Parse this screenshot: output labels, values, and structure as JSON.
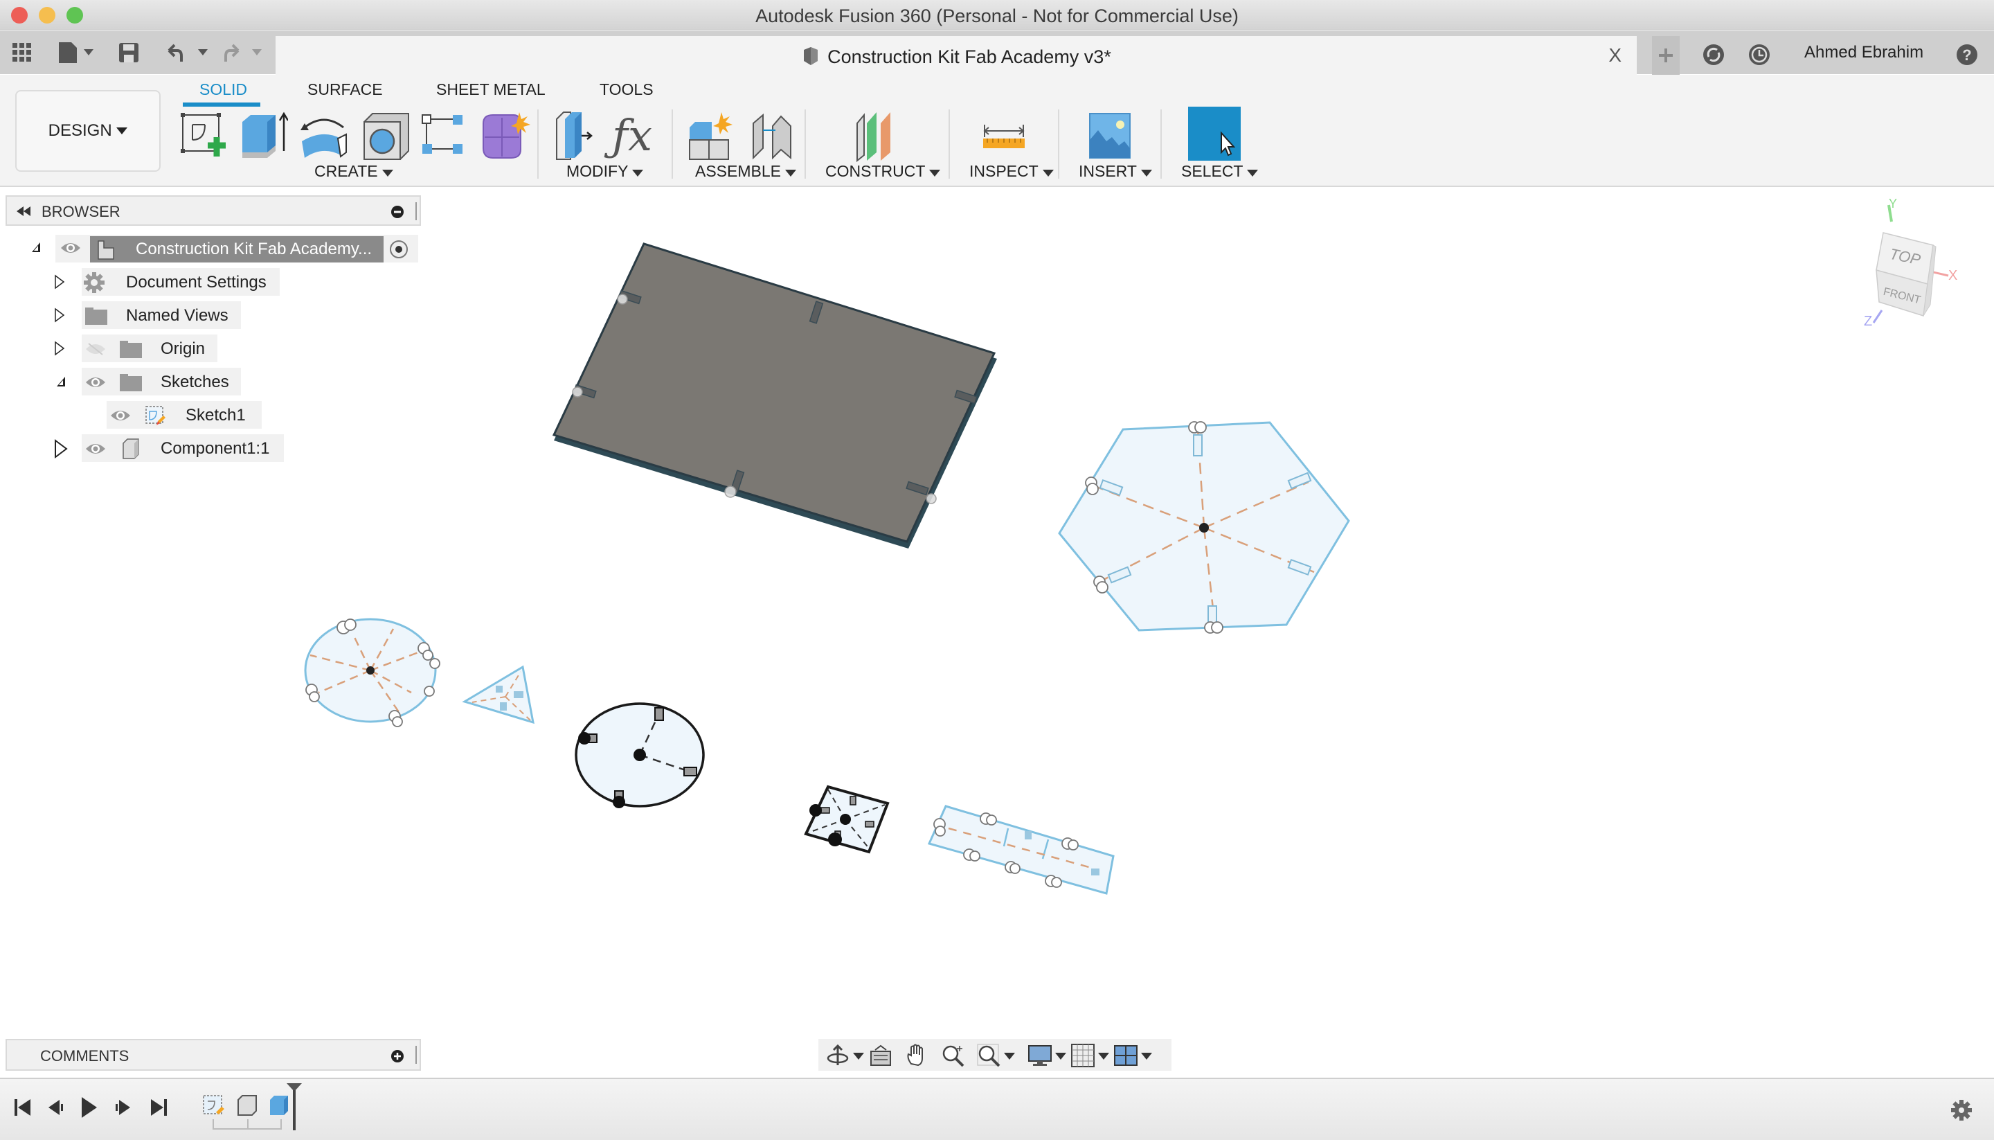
{
  "window": {
    "title": "Autodesk Fusion 360 (Personal - Not for Commercial Use)",
    "traffic_lights": {
      "close": "#ed5e57",
      "minimize": "#f5be4f",
      "zoom": "#5fc453"
    }
  },
  "appbar": {
    "document_title": "Construction Kit Fab Academy v3*",
    "user_name": "Ahmed Ebrahim",
    "icons": [
      "grid-icon",
      "file-icon",
      "save-icon",
      "undo-icon",
      "redo-icon",
      "close-tab-icon",
      "new-tab-icon",
      "jobs-icon",
      "history-icon",
      "help-icon"
    ],
    "close_glyph": "X"
  },
  "ribbon": {
    "workspace_label": "DESIGN",
    "tabs": [
      {
        "label": "SOLID",
        "active": true
      },
      {
        "label": "SURFACE",
        "active": false
      },
      {
        "label": "SHEET METAL",
        "active": false
      },
      {
        "label": "TOOLS",
        "active": false
      }
    ],
    "groups": [
      {
        "label": "CREATE",
        "tools": [
          "create-sketch",
          "extrude",
          "revolve",
          "hole",
          "pattern",
          "create-form"
        ]
      },
      {
        "label": "MODIFY",
        "tools": [
          "press-pull",
          "parameters"
        ]
      },
      {
        "label": "ASSEMBLE",
        "tools": [
          "new-component",
          "joint"
        ]
      },
      {
        "label": "CONSTRUCT",
        "tools": [
          "offset-plane"
        ]
      },
      {
        "label": "INSPECT",
        "tools": [
          "measure"
        ]
      },
      {
        "label": "INSERT",
        "tools": [
          "insert-image"
        ]
      },
      {
        "label": "SELECT",
        "tools": [
          "select"
        ]
      }
    ],
    "accent_color": "#1a8dc8"
  },
  "browser": {
    "title": "BROWSER",
    "root": {
      "label": "Construction Kit Fab Academy...",
      "expanded": true
    },
    "items": [
      {
        "label": "Document Settings",
        "icon": "gear-icon",
        "expanded": false,
        "visible_toggle": false
      },
      {
        "label": "Named Views",
        "icon": "folder-icon",
        "expanded": false,
        "visible_toggle": false
      },
      {
        "label": "Origin",
        "icon": "folder-icon",
        "expanded": false,
        "visible_toggle": "hidden"
      },
      {
        "label": "Sketches",
        "icon": "folder-icon",
        "expanded": true,
        "visible_toggle": "visible"
      },
      {
        "label": "Sketch1",
        "icon": "sketch-icon",
        "child": true,
        "visible_toggle": "visible"
      },
      {
        "label": "Component1:1",
        "icon": "component-icon",
        "expanded": false,
        "visible_toggle": "visible"
      }
    ]
  },
  "viewcube": {
    "top": "TOP",
    "front": "FRONT",
    "axes": {
      "x": "X",
      "y": "Y",
      "z": "Z"
    }
  },
  "comments": {
    "title": "COMMENTS"
  },
  "navbar": {
    "icons": [
      "orbit-icon",
      "look-at-icon",
      "pan-icon",
      "zoom-icon",
      "fit-icon",
      "display-settings-icon",
      "grid-settings-icon",
      "viewports-icon"
    ]
  },
  "timeline": {
    "controls": [
      "first",
      "previous",
      "play",
      "next",
      "last"
    ],
    "features": [
      "sketch",
      "component",
      "extrude"
    ]
  }
}
